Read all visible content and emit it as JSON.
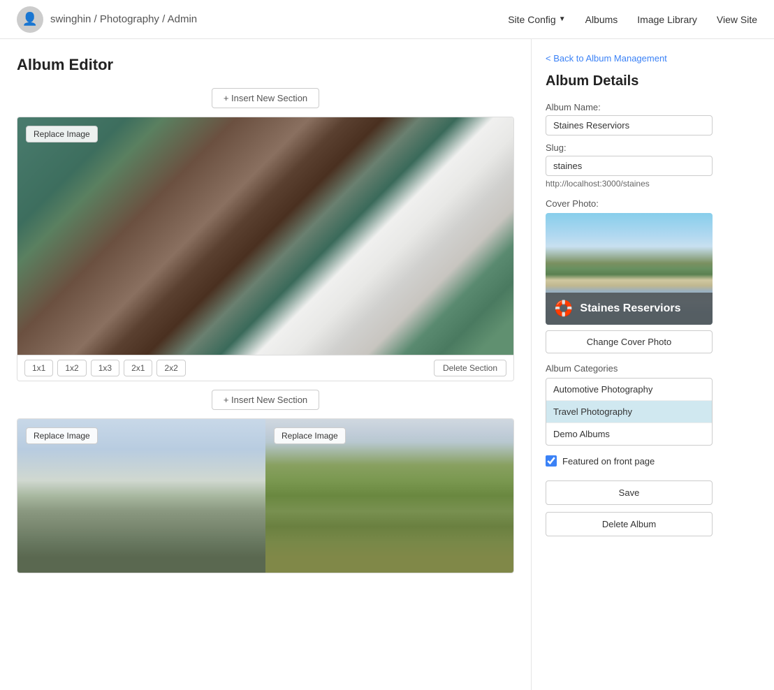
{
  "header": {
    "breadcrumb": "swinghin / Photography / Admin",
    "nav": {
      "site_config": "Site Config",
      "albums": "Albums",
      "image_library": "Image Library",
      "view_site": "View Site"
    }
  },
  "editor": {
    "title": "Album Editor",
    "insert_section_label": "+ Insert New Section",
    "sections": [
      {
        "id": "section-1",
        "layout": "1x1",
        "images": [
          {
            "replace_label": "Replace Image"
          }
        ],
        "toolbar": {
          "layouts": [
            "1x1",
            "1x2",
            "1x3",
            "2x1",
            "2x2"
          ],
          "delete_label": "Delete Section"
        }
      },
      {
        "id": "section-2",
        "layout": "2x1",
        "images": [
          {
            "replace_label": "Replace Image"
          },
          {
            "replace_label": "Replace Image"
          }
        ]
      }
    ]
  },
  "details": {
    "back_link": "< Back to Album Management",
    "title": "Album Details",
    "album_name_label": "Album Name:",
    "album_name_value": "Staines Reserviors",
    "slug_label": "Slug:",
    "slug_value": "staines",
    "slug_url": "http://localhost:3000/staines",
    "cover_photo_label": "Cover Photo:",
    "cover_photo_overlay_text": "Staines Reserviors",
    "change_cover_label": "Change Cover Photo",
    "categories_label": "Album Categories",
    "categories": [
      {
        "name": "Automotive Photography",
        "selected": false
      },
      {
        "name": "Travel Photography",
        "selected": true
      },
      {
        "name": "Demo Albums",
        "selected": false
      }
    ],
    "featured_label": "Featured on front page",
    "featured_checked": true,
    "save_label": "Save",
    "delete_album_label": "Delete Album"
  }
}
